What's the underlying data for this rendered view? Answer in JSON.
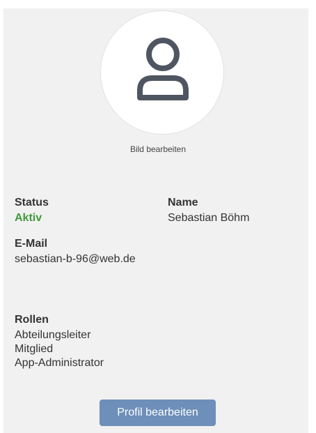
{
  "profile": {
    "edit_photo_label": "Bild bearbeiten",
    "status": {
      "label": "Status",
      "value": "Aktiv"
    },
    "name": {
      "label": "Name",
      "value": "Sebastian Böhm"
    },
    "email": {
      "label": "E-Mail",
      "value": "sebastian-b-96@web.de"
    },
    "roles": {
      "label": "Rollen",
      "items": [
        "Abteilungsleiter",
        "Mitglied",
        "App-Administrator"
      ]
    },
    "edit_profile_button": "Profil bearbeiten"
  },
  "colors": {
    "panel_background": "#f1f1f1",
    "status_active": "#3f9a3a",
    "button_background": "#6d8fb9"
  },
  "icons": {
    "avatar": "user-icon"
  }
}
